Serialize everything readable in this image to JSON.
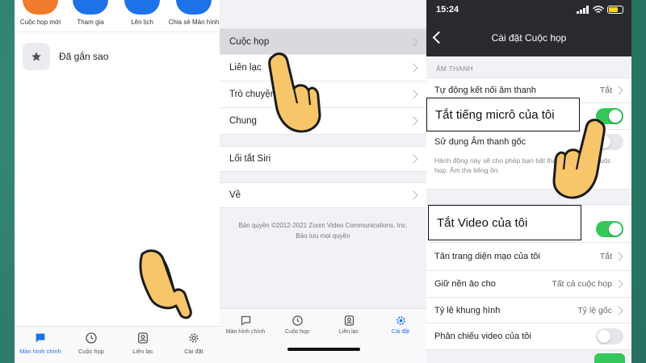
{
  "panel1": {
    "top_buttons": [
      "Cuộc họp mới",
      "Tham gia",
      "Lên lịch",
      "Chia sẻ Màn hình"
    ],
    "starred_label": "Đã gắn sao",
    "tabs": [
      "Màn hình chính",
      "Cuộc họp",
      "Liên lạc",
      "Cài đặt"
    ]
  },
  "panel2": {
    "menu": [
      "Cuộc họp",
      "Liên lạc",
      "Trò chuyện",
      "Chung",
      "Lối tắt Siri",
      "Về"
    ],
    "copyright_line1": "Bản quyền ©2012-2021 Zoom Video Communications, Inc.",
    "copyright_line2": "Bảo lưu mọi quyền",
    "tabs": [
      "Màn hình chính",
      "Cuộc họp",
      "Liên lạc",
      "Cài đặt"
    ]
  },
  "panel3": {
    "time": "15:24",
    "title": "Cài đặt Cuộc họp",
    "section_audio": "ÂM THANH",
    "auto_connect_label": "Tự động kết nối âm thanh",
    "auto_connect_value": "Tắt",
    "original_sound_label": "Sử dụng Âm thanh gốc",
    "original_sound_desc": "Hành động này sẽ cho phép bạn bật thanh gốc trong cuộc họp. Âm tha tiếng ồn.",
    "appearance_label": "Tân trang diện mạo của tôi",
    "appearance_value": "Tắt",
    "bg_label": "Giữ nền ảo cho",
    "bg_value": "Tất cả cuộc họp",
    "aspect_label": "Tỷ lệ khung hình",
    "aspect_value": "Tỷ lệ gốc",
    "mirror_label": "Phản chiếu video của tôi",
    "callout_mic": "Tắt tiếng micrô của tôi",
    "callout_video": "Tắt Video của tôi"
  },
  "colors": {
    "zoom_blue": "#1e72e8",
    "toggle_on": "#34c759",
    "background": "#2f7d6e",
    "hand": "#f7c66b"
  }
}
